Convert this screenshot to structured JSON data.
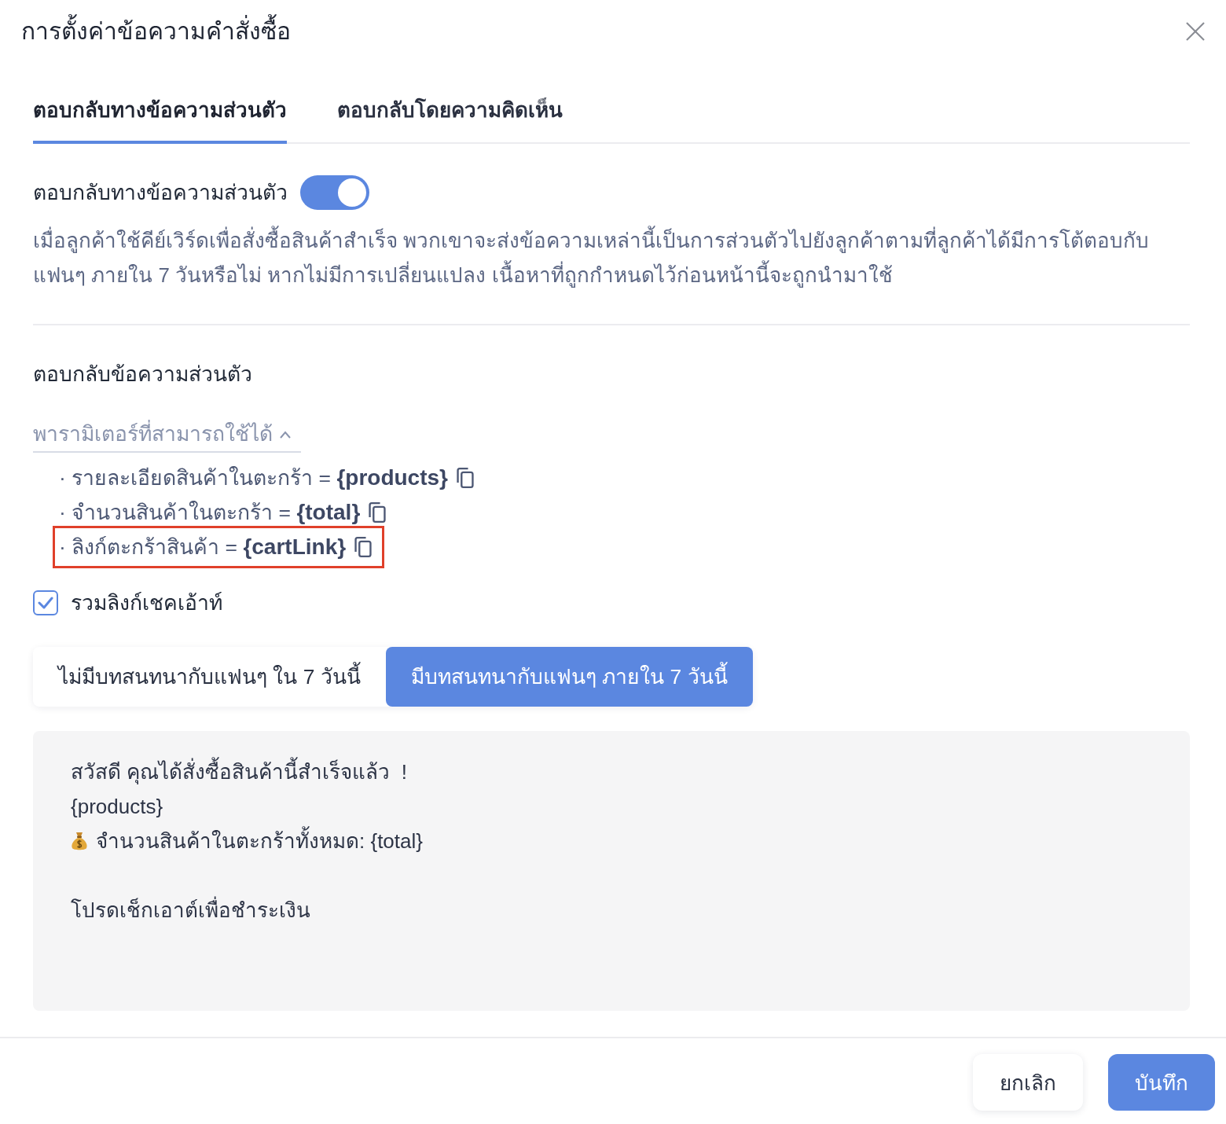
{
  "dialog": {
    "title": "การตั้งค่าข้อความคำสั่งซื้อ"
  },
  "tabs": [
    {
      "label": "ตอบกลับทางข้อความส่วนตัว",
      "selected": true
    },
    {
      "label": "ตอบกลับโดยความคิดเห็น",
      "selected": false
    }
  ],
  "private_reply": {
    "label": "ตอบกลับทางข้อความส่วนตัว",
    "on": true,
    "description": "เมื่อลูกค้าใช้คีย์เวิร์ดเพื่อสั่งซื้อสินค้าสำเร็จ พวกเขาจะส่งข้อความเหล่านี้เป็นการส่วนตัวไปยังลูกค้าตามที่ลูกค้าได้มีการโต้ตอบกับแฟนๆ ภายใน 7 วันหรือไม่ หากไม่มีการเปลี่ยนแปลง เนื้อหาที่ถูกกำหนดไว้ก่อนหน้านี้จะถูกนำมาใช้"
  },
  "section": {
    "heading": "ตอบกลับข้อความส่วนตัว"
  },
  "parameters": {
    "label": "พารามิเตอร์ที่สามารถใช้ได้",
    "expanded": true,
    "items": [
      {
        "text": "· รายละเอียดสินค้าในตะกร้า = **{products}**",
        "highlighted": false
      },
      {
        "text": "· จำนวนสินค้าในตะกร้า = **{total}**",
        "highlighted": false
      },
      {
        "text": "· ลิงก์ตะกร้าสินค้า = **{cartLink}**",
        "highlighted": true
      }
    ]
  },
  "include_checkout_link": {
    "label": "รวมลิงก์เชคเอ้าท์",
    "checked": true
  },
  "audience_options": [
    {
      "label": "ไม่มีบทสนทนากับแฟนๆ ใน 7 วันนี้",
      "selected": false
    },
    {
      "label": "มีบทสนทนากับแฟนๆ ภายใน 7 วันนี้",
      "selected": true
    }
  ],
  "message": {
    "lines": [
      {
        "kind": "text",
        "text": "สวัสดี คุณได้สั่งซื้อสินค้านี้สำเร็จแล้ว  !"
      },
      {
        "kind": "text",
        "text": "{products}"
      },
      {
        "kind": "money",
        "text": "จำนวนสินค้าในตะกร้าทั้งหมด: {total}"
      },
      {
        "kind": "blank"
      },
      {
        "kind": "text",
        "text": "โปรดเช็กเอาต์เพื่อชำระเงิน"
      }
    ]
  },
  "buttons": [
    {
      "label": "ยกเลิก",
      "kind": "secondary"
    },
    {
      "label": "บันทึก",
      "kind": "primary"
    }
  ]
}
